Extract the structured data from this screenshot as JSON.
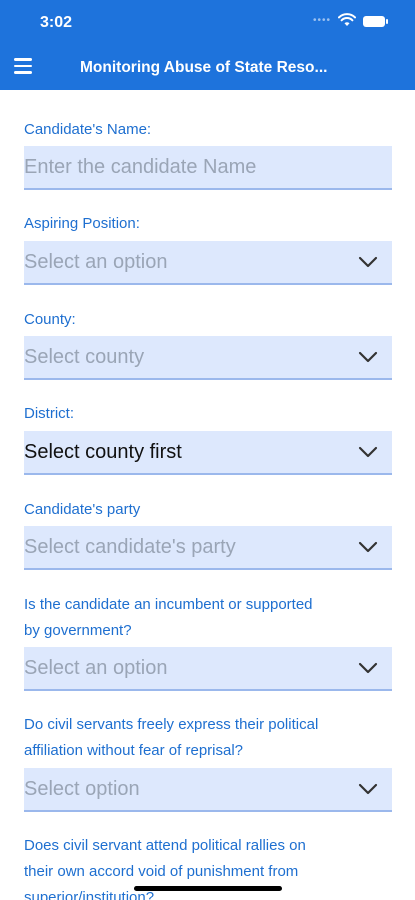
{
  "status": {
    "time": "3:02"
  },
  "header": {
    "title": "Monitoring Abuse of State Reso..."
  },
  "form": {
    "candidate_name": {
      "label": "Candidate's Name:",
      "placeholder": "Enter the candidate Name"
    },
    "aspiring_position": {
      "label": "Aspiring Position:",
      "value": "Select an option"
    },
    "county": {
      "label": "County:",
      "value": "Select county"
    },
    "district": {
      "label": "District:",
      "value": "Select county first"
    },
    "party": {
      "label": "Candidate's party",
      "value": "Select candidate's party"
    },
    "incumbent": {
      "label_line1": "Is the candidate an incumbent or supported",
      "label_line2": "by government?",
      "value": "Select an option"
    },
    "civil_express": {
      "label_line1": "Do civil servants freely express their political",
      "label_line2": "affiliation without fear of reprisal?",
      "value": "Select option"
    },
    "civil_rallies": {
      "label_line1": "Does civil servant attend political rallies on",
      "label_line2": "their own accord void of punishment from",
      "label_line3": "superior/institution?"
    }
  },
  "icons": {
    "menu": "hamburger-icon",
    "dropdown": "chevron-down-icon"
  },
  "colors": {
    "header_bg": "#1e73dc",
    "label": "#1e6fd0",
    "field_bg": "#dde8fd"
  }
}
